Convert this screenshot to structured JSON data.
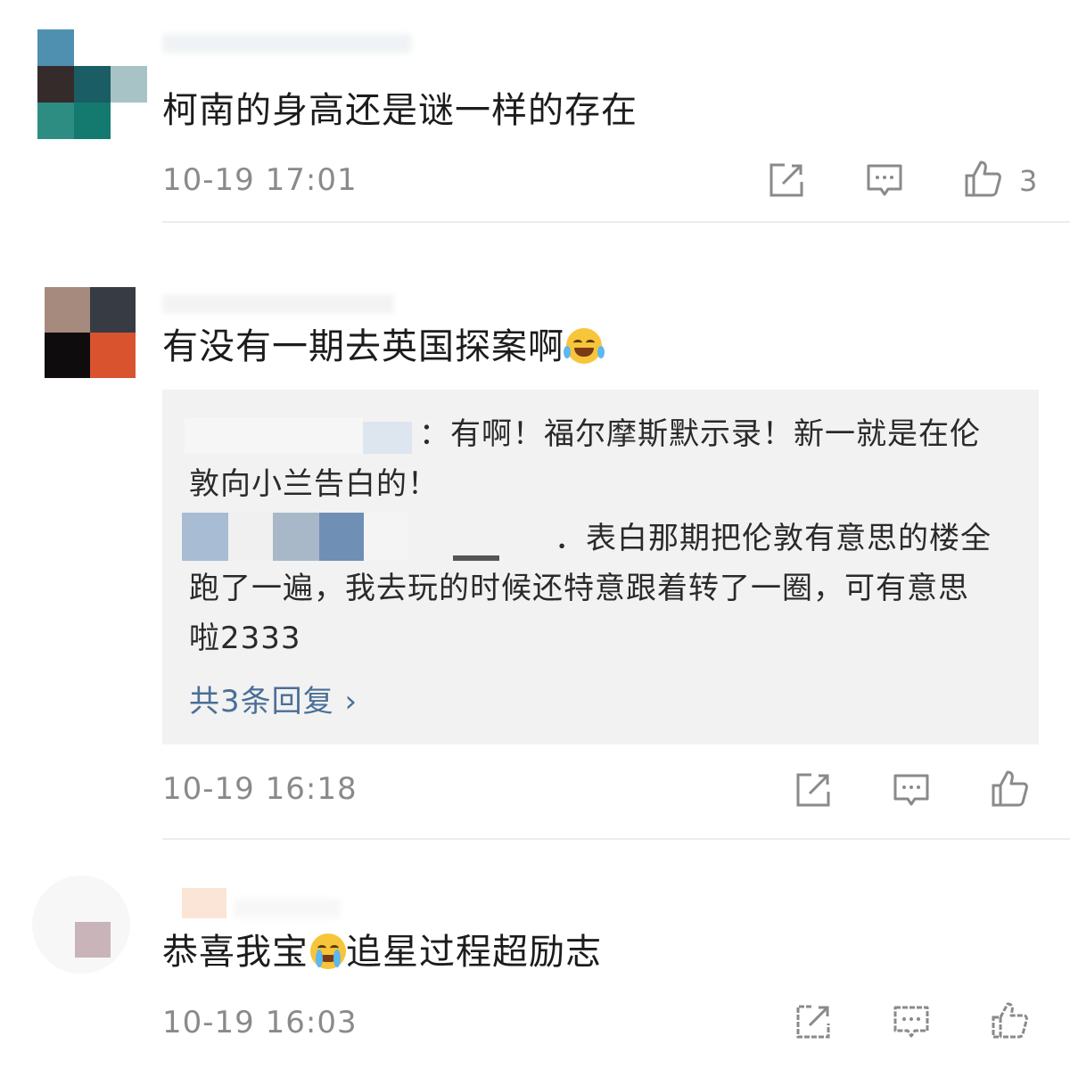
{
  "comments": [
    {
      "text": "柯南的身高还是谜一样的存在",
      "time": "10-19 17:01",
      "likes": "3"
    },
    {
      "text": "有没有一期去英国探案啊",
      "emoji": "laugh-cry-emoji",
      "time": "10-19 16:18",
      "replies": {
        "line1": "：有啊！福尔摩斯默示录！新一就是在伦",
        "line2": "敦向小兰告白的！",
        "line3": "．表白那期把伦敦有意思的楼全",
        "line4": "跑了一遍，我去玩的时候还特意跟着转了一圈，可有意思",
        "line5": "啦2333",
        "more": "共3条回复 ›"
      }
    },
    {
      "text_before": "恭喜我宝",
      "emoji": "crying-emoji",
      "text_after": "追星过程超励志",
      "time": "10-19 16:03"
    }
  ],
  "icons": {
    "share": "share-icon",
    "comment": "comment-icon",
    "like": "like-icon"
  },
  "colors": {
    "link": "#4a6f98",
    "meta": "#8a8a8a",
    "reply_bg": "#f2f2f2"
  }
}
